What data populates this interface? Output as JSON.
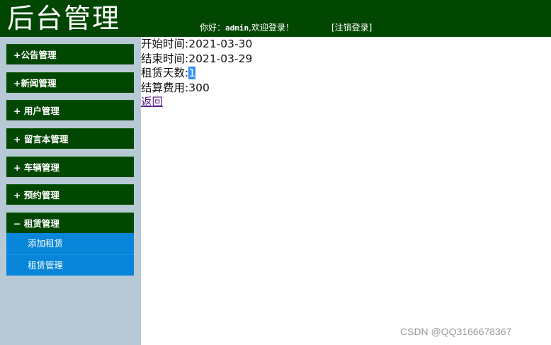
{
  "header": {
    "title": "后台管理",
    "welcome_prefix": "你好：",
    "username": "admin",
    "welcome_suffix": ",欢迎登录！",
    "logout_label": "[注销登录]"
  },
  "sidebar": {
    "items": [
      {
        "label": "+公告管理"
      },
      {
        "label": "+新闻管理"
      },
      {
        "label": "+ 用户管理"
      },
      {
        "label": "+ 留言本管理"
      },
      {
        "label": "+ 车辆管理"
      },
      {
        "label": "+ 预约管理"
      },
      {
        "label": "− 租赁管理"
      }
    ],
    "subitems": [
      {
        "label": "添加租赁"
      },
      {
        "label": "租赁管理"
      }
    ]
  },
  "detail": {
    "start_label": "开始时间:",
    "start_value": "2021-03-30",
    "end_label": "结束时间:",
    "end_value": "2021-03-29",
    "days_label": "租赁天数:",
    "days_value": "1",
    "fee_label": "结算费用:",
    "fee_value": "300",
    "back_label": "返回"
  },
  "watermark": "CSDN @QQ3166678367",
  "colors": {
    "header_bg": "#024701",
    "sidebar_bg": "#b8c9d6",
    "submenu_bg": "#0785d8"
  }
}
